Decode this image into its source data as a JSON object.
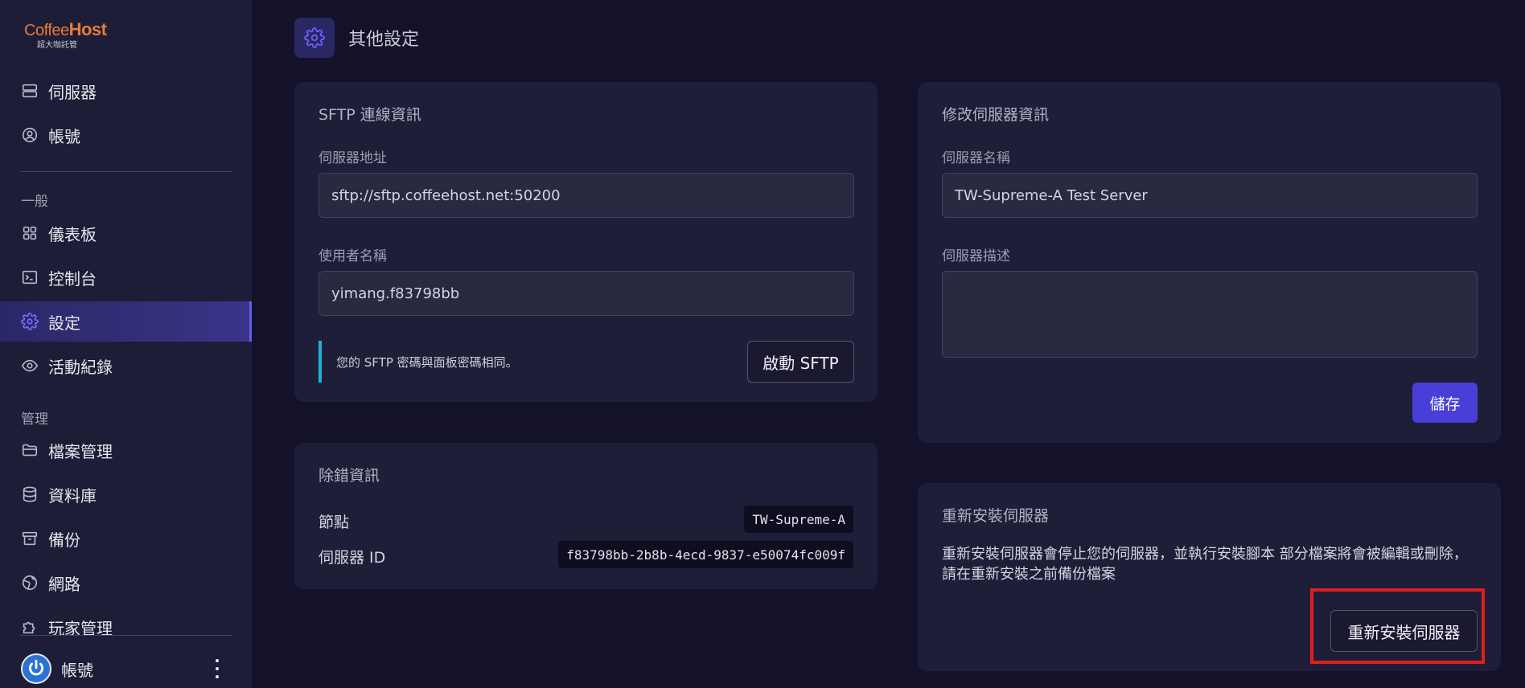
{
  "brand": {
    "word1": "Coffee",
    "word2": "Host",
    "tagline": "超大咖託管"
  },
  "sidebar": {
    "top_items": [
      {
        "label": "伺服器",
        "icon": "server-icon"
      },
      {
        "label": "帳號",
        "icon": "user-circle-icon"
      }
    ],
    "section_general": "一般",
    "general_items": [
      {
        "label": "儀表板",
        "icon": "dashboard-icon"
      },
      {
        "label": "控制台",
        "icon": "terminal-icon"
      },
      {
        "label": "設定",
        "icon": "gear-icon",
        "active": true
      },
      {
        "label": "活動紀錄",
        "icon": "eye-icon"
      }
    ],
    "section_manage": "管理",
    "manage_items": [
      {
        "label": "檔案管理",
        "icon": "folder-icon"
      },
      {
        "label": "資料庫",
        "icon": "database-icon"
      },
      {
        "label": "備份",
        "icon": "archive-icon"
      },
      {
        "label": "網路",
        "icon": "globe-icon"
      },
      {
        "label": "玩家管理",
        "icon": "puzzle-icon"
      }
    ],
    "account_label": "帳號"
  },
  "header": {
    "title": "其他設定"
  },
  "sftp": {
    "title": "SFTP 連線資訊",
    "address_label": "伺服器地址",
    "address_value": "sftp://sftp.coffeehost.net:50200",
    "username_label": "使用者名稱",
    "username_value": "yimang.f83798bb",
    "note": "您的 SFTP 密碼與面板密碼相同。",
    "launch_button": "啟動 SFTP"
  },
  "debug": {
    "title": "除錯資訊",
    "node_label": "節點",
    "node_value": "TW-Supreme-A",
    "server_id_label": "伺服器 ID",
    "server_id_value": "f83798bb-2b8b-4ecd-9837-e50074fc009f"
  },
  "edit": {
    "title": "修改伺服器資訊",
    "name_label": "伺服器名稱",
    "name_value": "TW-Supreme-A Test Server",
    "desc_label": "伺服器描述",
    "desc_value": "",
    "save_button": "儲存"
  },
  "reinstall": {
    "title": "重新安裝伺服器",
    "description": "重新安裝伺服器會停止您的伺服器，並執行安裝腳本 部分檔案將會被編輯或刪除，請在重新安裝之前備份檔案",
    "button": "重新安裝伺服器"
  },
  "colors": {
    "background": "#13122a",
    "sidebar": "#1e1d37",
    "card": "#1f1e38",
    "accent": "#4a3ed8",
    "info_bar": "#1fb2d8",
    "highlight": "#e01e1e",
    "brand": "#e87a3a"
  }
}
